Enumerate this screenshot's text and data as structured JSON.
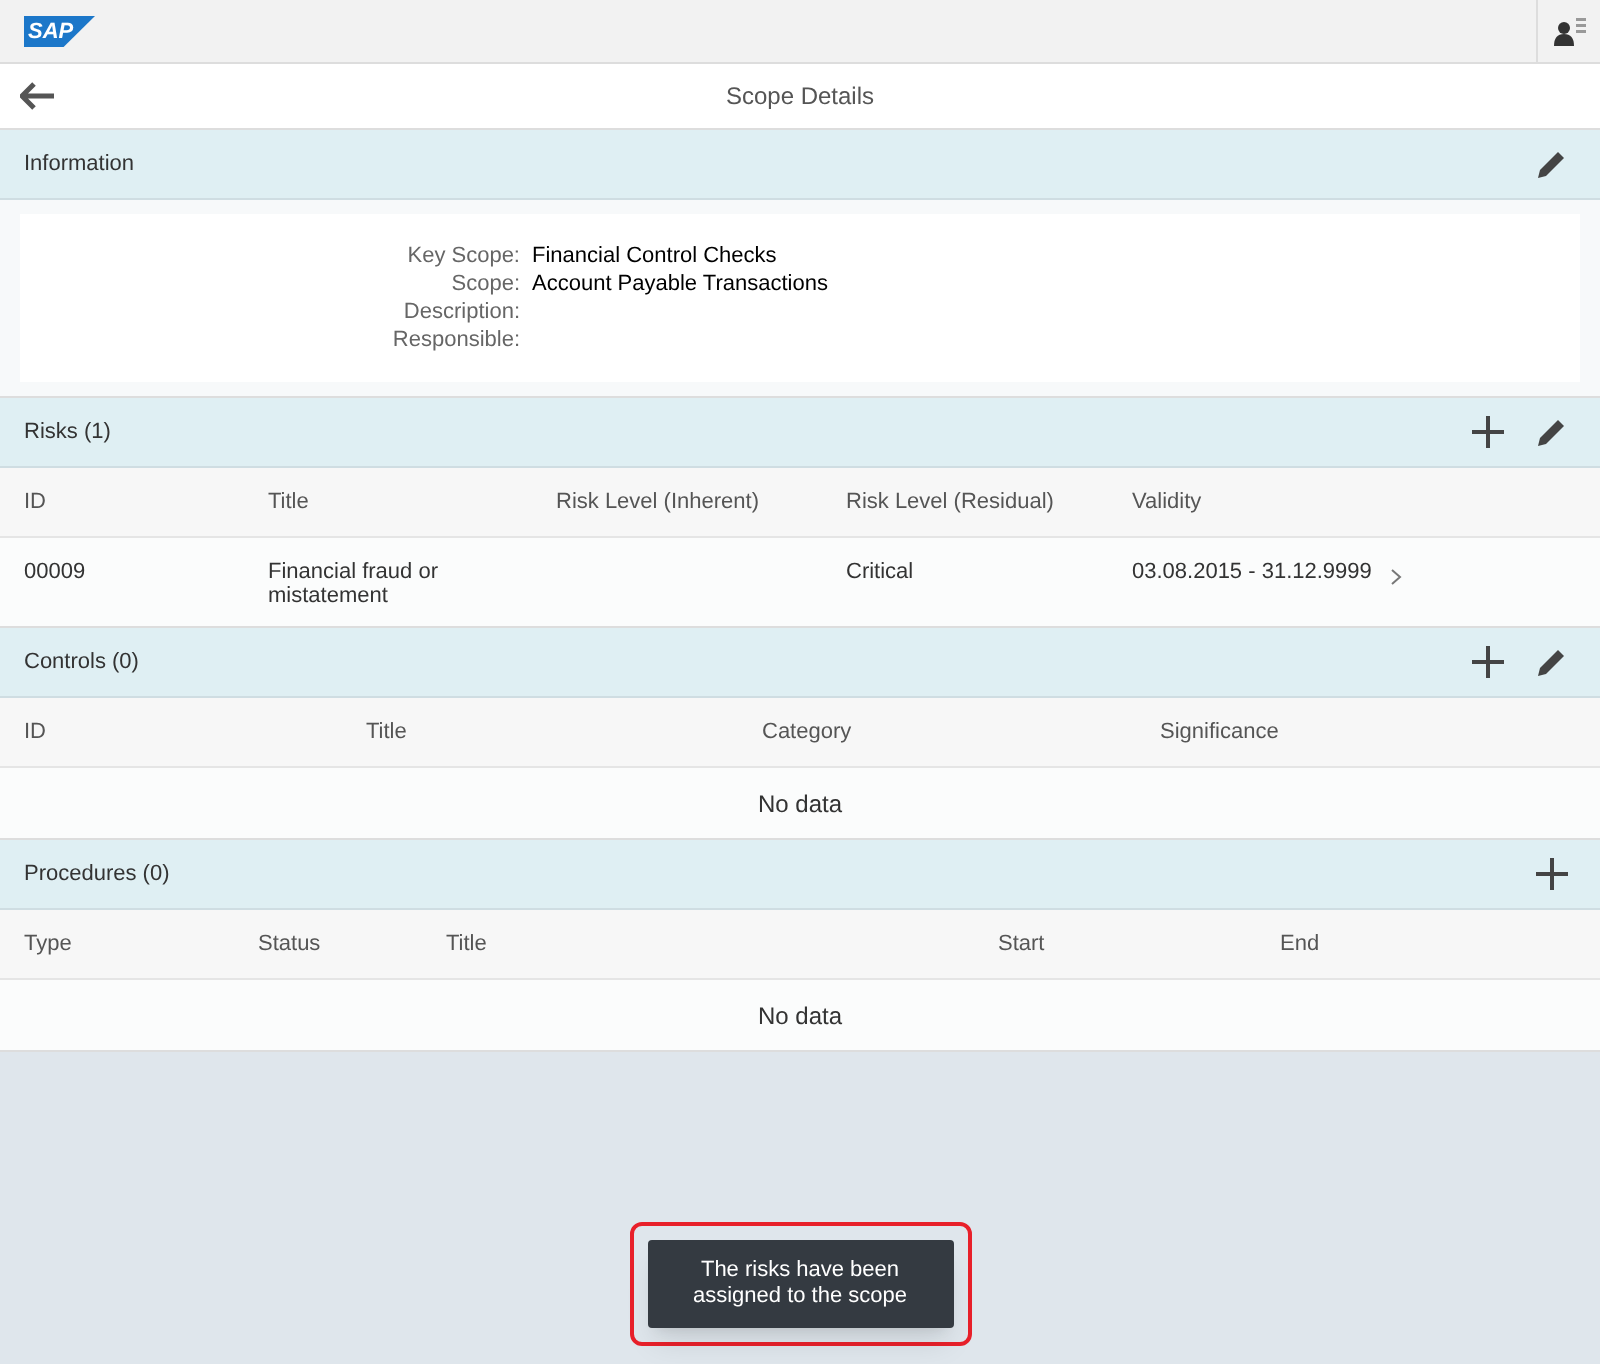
{
  "shell": {
    "logo": "SAP"
  },
  "page": {
    "title": "Scope Details"
  },
  "sections": [
    {
      "kind": "form",
      "title": "Information",
      "actions": [
        {
          "kind": "edit"
        }
      ],
      "fields": [
        {
          "label": "Key Scope:",
          "value": "Financial Control Checks"
        },
        {
          "label": "Scope:",
          "value": "Account Payable Transactions"
        },
        {
          "label": "Description:"
        },
        {
          "label": "Responsible:"
        }
      ]
    },
    {
      "kind": "table",
      "title": "Risks (1)",
      "actions": [
        {
          "kind": "add"
        },
        {
          "kind": "edit"
        }
      ],
      "columns": [
        "ID",
        "Title",
        "Risk Level (Inherent)",
        "Risk Level (Residual)",
        "Validity"
      ],
      "rows": [
        {
          "cells": [
            "00009",
            "Financial fraud or mistatement",
            "",
            "Critical",
            "03.08.2015 - 31.12.9999"
          ],
          "navigable": true
        }
      ]
    },
    {
      "kind": "table",
      "title": "Controls (0)",
      "actions": [
        {
          "kind": "add"
        },
        {
          "kind": "edit"
        }
      ],
      "columns": [
        "ID",
        "Title",
        "Category",
        "Significance"
      ],
      "empty_text": "No data"
    },
    {
      "kind": "table",
      "title": "Procedures (0)",
      "actions": [
        {
          "kind": "add"
        }
      ],
      "columns": [
        "Type",
        "Status",
        "Title",
        "Start",
        "End"
      ],
      "empty_text": "No data"
    }
  ],
  "toast": {
    "message": "The risks have been assigned to the scope",
    "highlighted": true
  }
}
